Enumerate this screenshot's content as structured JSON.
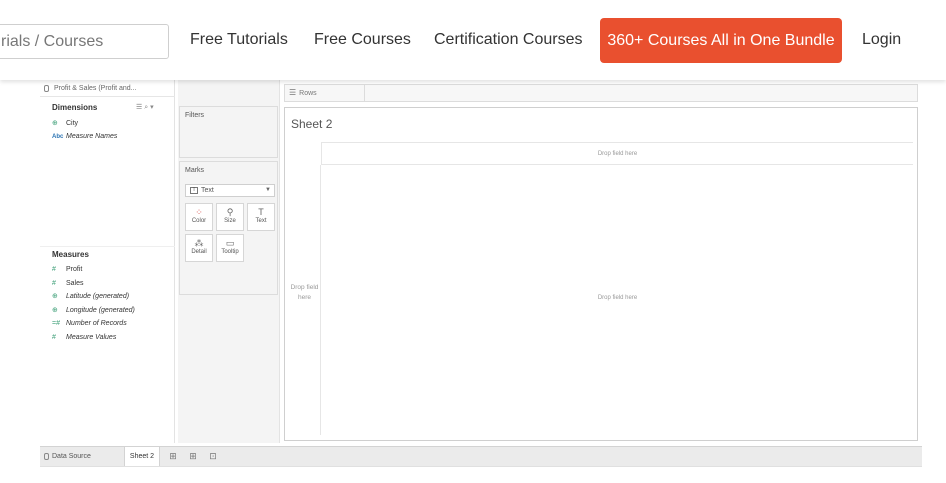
{
  "site_nav": {
    "search_value": "rials / Courses",
    "links": [
      {
        "label": "Free Tutorials"
      },
      {
        "label": "Free Courses"
      },
      {
        "label": "Certification Courses"
      }
    ],
    "cta_label": "360+ Courses All in One Bundle",
    "login_label": "Login",
    "cta_color": "#e9502f"
  },
  "tableau": {
    "data_source_label": "Profit & Sales (Profit and...",
    "dimensions": {
      "header": "Dimensions",
      "tools": "☰ ⌕ ▾",
      "fields": [
        {
          "icon": "globe",
          "glyph": "⊕",
          "label": "City",
          "italic": false
        },
        {
          "icon": "abc",
          "glyph": "Abc",
          "label": "Measure Names",
          "italic": true
        }
      ]
    },
    "measures": {
      "header": "Measures",
      "fields": [
        {
          "icon": "hash",
          "glyph": "#",
          "label": "Profit",
          "italic": false
        },
        {
          "icon": "hash",
          "glyph": "#",
          "label": "Sales",
          "italic": false
        },
        {
          "icon": "globe",
          "glyph": "⊕",
          "label": "Latitude (generated)",
          "italic": true
        },
        {
          "icon": "globe",
          "glyph": "⊕",
          "label": "Longitude (generated)",
          "italic": true
        },
        {
          "icon": "hash",
          "glyph": "=#",
          "label": "Number of Records",
          "italic": true
        },
        {
          "icon": "hash",
          "glyph": "#",
          "label": "Measure Values",
          "italic": true
        }
      ]
    },
    "filters_label": "Filters",
    "marks": {
      "label": "Marks",
      "type": "Text",
      "buttons": [
        {
          "name": "color",
          "label": "Color",
          "glyph": "⁘"
        },
        {
          "name": "size",
          "label": "Size",
          "glyph": "⚲"
        },
        {
          "name": "text",
          "label": "Text",
          "glyph": "T"
        },
        {
          "name": "detail",
          "label": "Detail",
          "glyph": "⁂"
        },
        {
          "name": "tooltip",
          "label": "Tooltip",
          "glyph": "▭"
        }
      ]
    },
    "rows_label": "Rows",
    "sheet_title": "Sheet 2",
    "drop_column": "Drop field here",
    "drop_row": "Drop field here",
    "drop_body": "Drop field here",
    "tabs": {
      "data_source": "Data Source",
      "active_sheet": "Sheet 2"
    }
  }
}
